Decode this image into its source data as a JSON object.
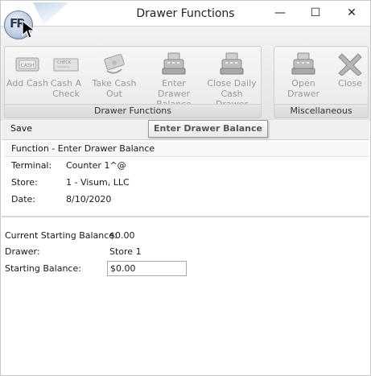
{
  "window": {
    "title": "Drawer Functions",
    "app_orb_glyph": "FR",
    "controls": {
      "minimize": "—",
      "maximize": "☐",
      "close": "✕"
    }
  },
  "ribbon": {
    "groups": [
      {
        "label": "Drawer Functions",
        "buttons": [
          {
            "label": "Add Cash",
            "icon": "cash-icon"
          },
          {
            "label": "Cash A Check",
            "icon": "check-icon"
          },
          {
            "label": "Take Cash Out",
            "icon": "cash-out-icon"
          },
          {
            "label": "Enter Drawer Balance",
            "icon": "register-icon"
          },
          {
            "label": "Close Daily Cash Drawer",
            "icon": "register-icon"
          }
        ]
      },
      {
        "label": "Miscellaneous",
        "buttons": [
          {
            "label": "Open Drawer",
            "icon": "register-icon"
          },
          {
            "label": "Close",
            "icon": "close-x-icon"
          }
        ]
      }
    ]
  },
  "tooltip": "Enter Drawer Balance",
  "toolbar": {
    "save_label": "Save"
  },
  "function_panel": {
    "header": "Function - Enter Drawer Balance",
    "terminal_label": "Terminal:",
    "terminal_value": "Counter 1^@",
    "store_label": "Store:",
    "store_value": "1 - Visum, LLC",
    "date_label": "Date:",
    "date_value": "8/10/2020"
  },
  "balance_panel": {
    "current_label": "Current Starting Balance:",
    "current_value": "$0.00",
    "drawer_label": "Drawer:",
    "drawer_value": "Store 1",
    "starting_label": "Starting Balance:",
    "starting_value": "$0.00"
  }
}
